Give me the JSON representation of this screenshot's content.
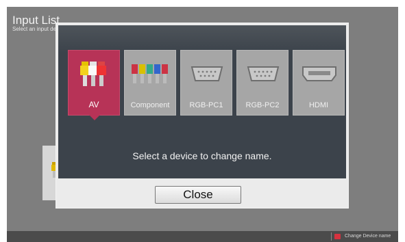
{
  "background": {
    "title": "Input List",
    "subtitle": "Select an input device to view.",
    "footer_hint": "Change Device name",
    "footer_key_color": "#d6323f"
  },
  "modal": {
    "devices": [
      {
        "label": "AV",
        "icon": "composite-av-jacks-icon",
        "selected": true
      },
      {
        "label": "Component",
        "icon": "component-jacks-icon",
        "selected": false
      },
      {
        "label": "RGB-PC1",
        "icon": "vga-port-icon",
        "selected": false
      },
      {
        "label": "RGB-PC2",
        "icon": "vga-port-icon",
        "selected": false
      },
      {
        "label": "HDMI",
        "icon": "hdmi-port-icon",
        "selected": false
      }
    ],
    "message": "Select a device to change name.",
    "close_label": "Close"
  },
  "colors": {
    "selected_tile": "#b73357",
    "panel": "#3c434b",
    "tile": "#a6a6a6"
  }
}
